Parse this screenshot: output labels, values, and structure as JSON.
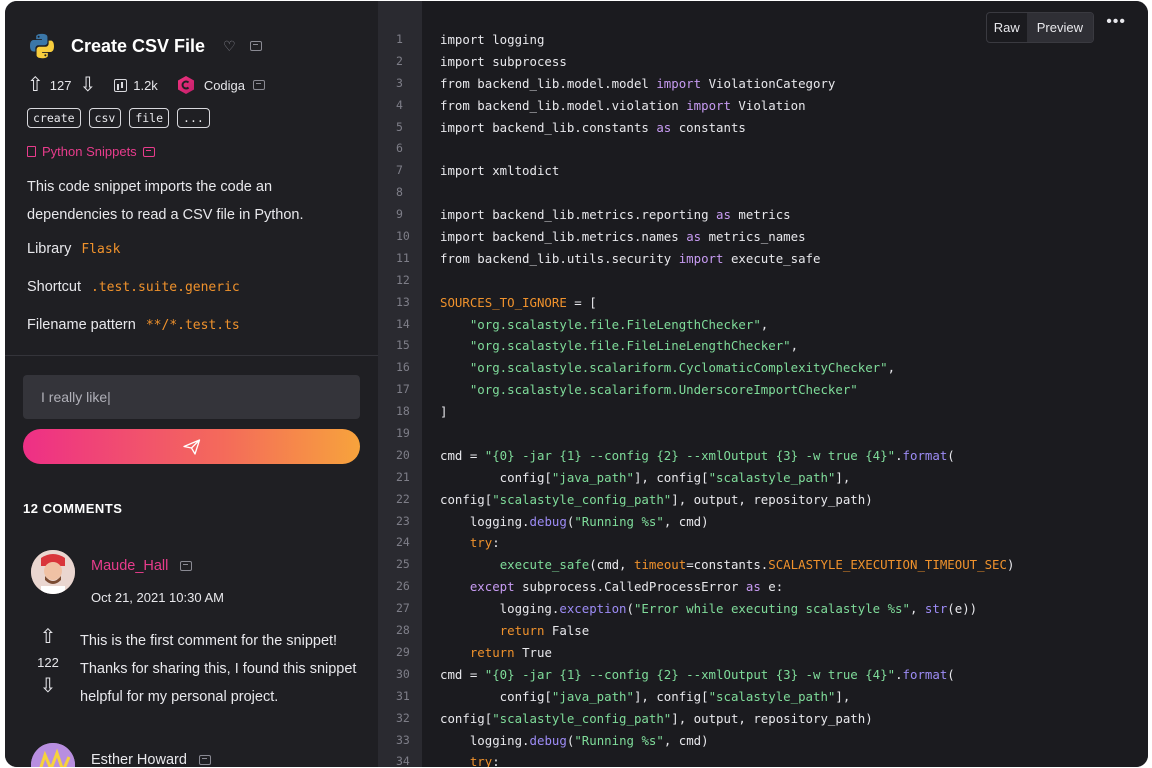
{
  "snippet": {
    "title": "Create CSV File",
    "upvotes": "127",
    "views": "1.2k",
    "owner": "Codiga",
    "tags": [
      "create",
      "csv",
      "file",
      "..."
    ],
    "collection": "Python Snippets",
    "description": "This code snippet imports the code an dependencies to read a CSV file in Python.",
    "library_label": "Library",
    "library_value": "Flask",
    "shortcut_label": "Shortcut",
    "shortcut_value": ".test.suite.generic",
    "filename_label": "Filename pattern",
    "filename_value": "**/*.test.ts"
  },
  "comment_form": {
    "input_value": "I really like|"
  },
  "comments": {
    "title": "12 COMMENTS",
    "items": [
      {
        "author": "Maude_Hall",
        "date": "Oct 21, 2021 10:30 AM",
        "votes": "122",
        "text": "This is the first comment for the snippet! Thanks for sharing this, I found this snippet helpful for my personal project."
      },
      {
        "author": "Esther Howard"
      }
    ]
  },
  "code_view": {
    "raw_label": "Raw",
    "preview_label": "Preview",
    "more_label": "•••",
    "active_tab": "Preview",
    "lines": [
      [
        [
          "import logging",
          "p"
        ]
      ],
      [
        [
          "import subprocess",
          "p"
        ]
      ],
      [
        [
          "from backend_lib.model.model ",
          "p"
        ],
        [
          "import",
          "kw"
        ],
        [
          " ViolationCategory",
          "p"
        ]
      ],
      [
        [
          "from backend_lib.model.violation ",
          "p"
        ],
        [
          "import",
          "kw"
        ],
        [
          " Violation",
          "p"
        ]
      ],
      [
        [
          "import backend_lib.constants ",
          "p"
        ],
        [
          "as",
          "kw"
        ],
        [
          " constants",
          "p"
        ]
      ],
      [],
      [
        [
          "import xmltodict",
          "p"
        ]
      ],
      [],
      [
        [
          "import backend_lib.metrics.reporting ",
          "p"
        ],
        [
          "as",
          "kw"
        ],
        [
          " metrics",
          "p"
        ]
      ],
      [
        [
          "import backend_lib.metrics.names ",
          "p"
        ],
        [
          "as",
          "kw"
        ],
        [
          " metrics_names",
          "p"
        ]
      ],
      [
        [
          "from backend_lib.utils.security ",
          "p"
        ],
        [
          "import",
          "kw"
        ],
        [
          " execute_safe",
          "p"
        ]
      ],
      [],
      [
        [
          "SOURCES_TO_IGNORE",
          "cn"
        ],
        [
          " = [",
          "p"
        ]
      ],
      [
        [
          "    ",
          "p"
        ],
        [
          "\"org.scalastyle.file.FileLengthChecker\"",
          "st"
        ],
        [
          ",",
          "p"
        ]
      ],
      [
        [
          "    ",
          "p"
        ],
        [
          "\"org.scalastyle.file.FileLineLengthChecker\"",
          "st"
        ],
        [
          ",",
          "p"
        ]
      ],
      [
        [
          "    ",
          "p"
        ],
        [
          "\"org.scalastyle.scalariform.CyclomaticComplexityChecker\"",
          "st"
        ],
        [
          ",",
          "p"
        ]
      ],
      [
        [
          "    ",
          "p"
        ],
        [
          "\"org.scalastyle.scalariform.UnderscoreImportChecker\"",
          "st"
        ]
      ],
      [
        [
          "]",
          "p"
        ]
      ],
      [],
      [
        [
          "cmd = ",
          "p"
        ],
        [
          "\"{0} -jar {1} --config {2} --xmlOutput {3} -w true {4}\"",
          "st"
        ],
        [
          ".",
          "p"
        ],
        [
          "format",
          "fn"
        ],
        [
          "(",
          "p"
        ]
      ],
      [
        [
          "        config[",
          "p"
        ],
        [
          "\"java_path\"",
          "st"
        ],
        [
          "], config[",
          "p"
        ],
        [
          "\"scalastyle_path\"",
          "st"
        ],
        [
          "],",
          "p"
        ]
      ],
      [
        [
          "config[",
          "p"
        ],
        [
          "\"scalastyle_config_path\"",
          "st"
        ],
        [
          "], output, repository_path)",
          "p"
        ]
      ],
      [
        [
          "    logging.",
          "p"
        ],
        [
          "debug",
          "fn"
        ],
        [
          "(",
          "p"
        ],
        [
          "\"Running %s\"",
          "st"
        ],
        [
          ", cmd)",
          "p"
        ]
      ],
      [
        [
          "    ",
          "p"
        ],
        [
          "try",
          "cn"
        ],
        [
          ":",
          "p"
        ]
      ],
      [
        [
          "        ",
          "p"
        ],
        [
          "execute_safe",
          "st"
        ],
        [
          "(cmd, ",
          "p"
        ],
        [
          "timeout",
          "cn"
        ],
        [
          "=constants.",
          "p"
        ],
        [
          "SCALASTYLE_EXECUTION_TIMEOUT_SEC",
          "cn"
        ],
        [
          ")",
          "p"
        ]
      ],
      [
        [
          "    ",
          "p"
        ],
        [
          "except",
          "kw"
        ],
        [
          " subprocess.CalledProcessError ",
          "p"
        ],
        [
          "as",
          "kw"
        ],
        [
          " e:",
          "p"
        ]
      ],
      [
        [
          "        logging.",
          "p"
        ],
        [
          "exception",
          "fn"
        ],
        [
          "(",
          "p"
        ],
        [
          "\"Error while executing scalastyle %s\"",
          "st"
        ],
        [
          ", ",
          "p"
        ],
        [
          "str",
          "fn"
        ],
        [
          "(e))",
          "p"
        ]
      ],
      [
        [
          "        ",
          "p"
        ],
        [
          "return",
          "cn"
        ],
        [
          " False",
          "p"
        ]
      ],
      [
        [
          "    ",
          "p"
        ],
        [
          "return",
          "cn"
        ],
        [
          " True",
          "p"
        ]
      ],
      [
        [
          "cmd = ",
          "p"
        ],
        [
          "\"{0} -jar {1} --config {2} --xmlOutput {3} -w true {4}\"",
          "st"
        ],
        [
          ".",
          "p"
        ],
        [
          "format",
          "fn"
        ],
        [
          "(",
          "p"
        ]
      ],
      [
        [
          "        config[",
          "p"
        ],
        [
          "\"java_path\"",
          "st"
        ],
        [
          "], config[",
          "p"
        ],
        [
          "\"scalastyle_path\"",
          "st"
        ],
        [
          "],",
          "p"
        ]
      ],
      [
        [
          "config[",
          "p"
        ],
        [
          "\"scalastyle_config_path\"",
          "st"
        ],
        [
          "], output, repository_path)",
          "p"
        ]
      ],
      [
        [
          "    logging.",
          "p"
        ],
        [
          "debug",
          "fn"
        ],
        [
          "(",
          "p"
        ],
        [
          "\"Running %s\"",
          "st"
        ],
        [
          ", cmd)",
          "p"
        ]
      ],
      [
        [
          "    ",
          "p"
        ],
        [
          "try",
          "cn"
        ],
        [
          ":",
          "p"
        ]
      ]
    ]
  }
}
